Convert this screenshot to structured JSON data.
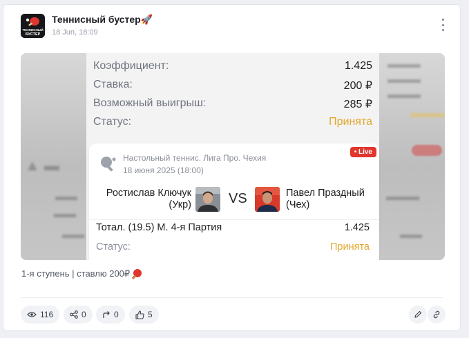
{
  "post": {
    "channel_name": "Теннисный бустер🚀",
    "time": "18 Jun, 18:09",
    "avatar_text": [
      "ТЕННИСНЫЙ",
      "БУСТЕР"
    ],
    "caption": "1-я ступень | ставлю 200₽",
    "caption_icon": "ping-pong-paddle-icon"
  },
  "slip": {
    "rows": [
      {
        "label": "Коэффициент:",
        "value": "1.425"
      },
      {
        "label": "Ставка:",
        "value": "200 ₽"
      },
      {
        "label": "Возможный выигрыш:",
        "value": "285 ₽"
      },
      {
        "label": "Статус:",
        "value": "Принята"
      }
    ],
    "bet": {
      "league": "Настольный теннис. Лига Про. Чехия",
      "date": "18 июня 2025 (18:00)",
      "live": "• Live",
      "player1": "Ростислав Ключук (Укр)",
      "vs": "VS",
      "player2": "Павел Праздный (Чех)",
      "market": "Тотал. (19.5) М. 4-я Партия",
      "odds": "1.425",
      "status_label": "Статус:",
      "status_value": "Принята"
    }
  },
  "stats": {
    "views": "116",
    "shares": "0",
    "forwards": "0",
    "likes": "5"
  },
  "colors": {
    "status": "#e0a82e",
    "live": "#e0362e",
    "paddle": "#e0362e"
  }
}
